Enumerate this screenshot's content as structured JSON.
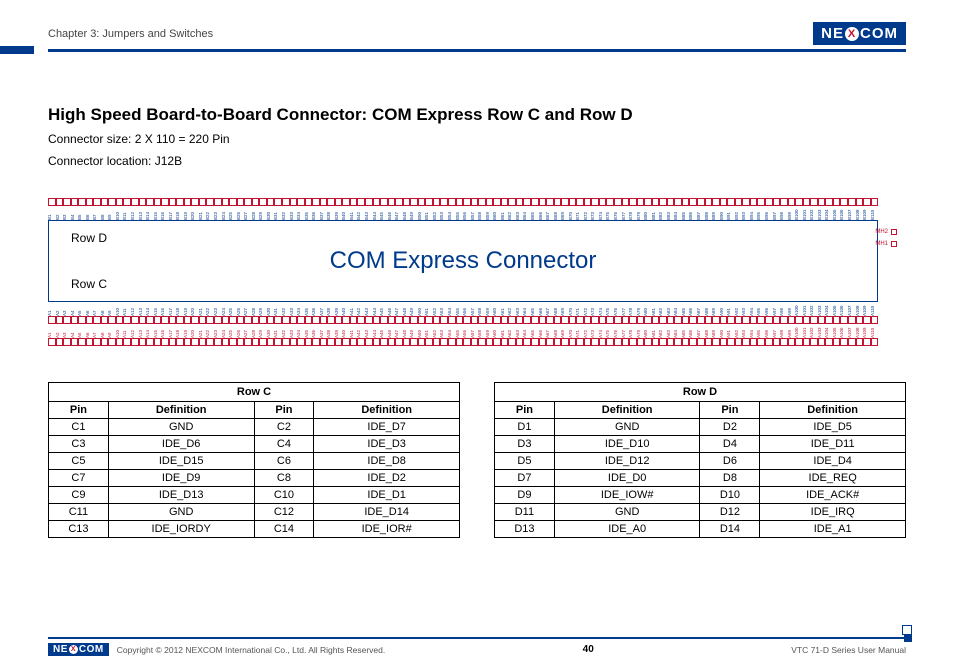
{
  "header": {
    "chapter": "Chapter 3: Jumpers and Switches",
    "brand_pre": "NE",
    "brand_x": "X",
    "brand_post": "COM"
  },
  "title": {
    "line": "High Speed Board-to-Board Connector: COM Express Row C and Row D",
    "sub1": "Connector size: 2 X 110 = 220 Pin",
    "sub2": "Connector location: J12B"
  },
  "diagram": {
    "row_d": "Row D",
    "row_c": "Row C",
    "center": "COM Express Connector",
    "mh1": "MH1",
    "mh2": "MH2",
    "top_prefix": "B",
    "bottom_prefix_outer": "A",
    "bottom_prefix_inner": "A",
    "pin_count": 110
  },
  "tables": {
    "rowC": {
      "caption": "Row C",
      "headers": [
        "Pin",
        "Definition",
        "Pin",
        "Definition"
      ],
      "rows": [
        [
          "C1",
          "GND",
          "C2",
          "IDE_D7"
        ],
        [
          "C3",
          "IDE_D6",
          "C4",
          "IDE_D3"
        ],
        [
          "C5",
          "IDE_D15",
          "C6",
          "IDE_D8"
        ],
        [
          "C7",
          "IDE_D9",
          "C8",
          "IDE_D2"
        ],
        [
          "C9",
          "IDE_D13",
          "C10",
          "IDE_D1"
        ],
        [
          "C11",
          "GND",
          "C12",
          "IDE_D14"
        ],
        [
          "C13",
          "IDE_IORDY",
          "C14",
          "IDE_IOR#"
        ]
      ]
    },
    "rowD": {
      "caption": "Row D",
      "headers": [
        "Pin",
        "Definition",
        "Pin",
        "Definition"
      ],
      "rows": [
        [
          "D1",
          "GND",
          "D2",
          "IDE_D5"
        ],
        [
          "D3",
          "IDE_D10",
          "D4",
          "IDE_D11"
        ],
        [
          "D5",
          "IDE_D12",
          "D6",
          "IDE_D4"
        ],
        [
          "D7",
          "IDE_D0",
          "D8",
          "IDE_REQ"
        ],
        [
          "D9",
          "IDE_IOW#",
          "D10",
          "IDE_ACK#"
        ],
        [
          "D11",
          "GND",
          "D12",
          "IDE_IRQ"
        ],
        [
          "D13",
          "IDE_A0",
          "D14",
          "IDE_A1"
        ]
      ]
    }
  },
  "footer": {
    "copyright": "Copyright © 2012 NEXCOM International Co., Ltd. All Rights Reserved.",
    "page": "40",
    "doc": "VTC 71-D Series User Manual"
  }
}
